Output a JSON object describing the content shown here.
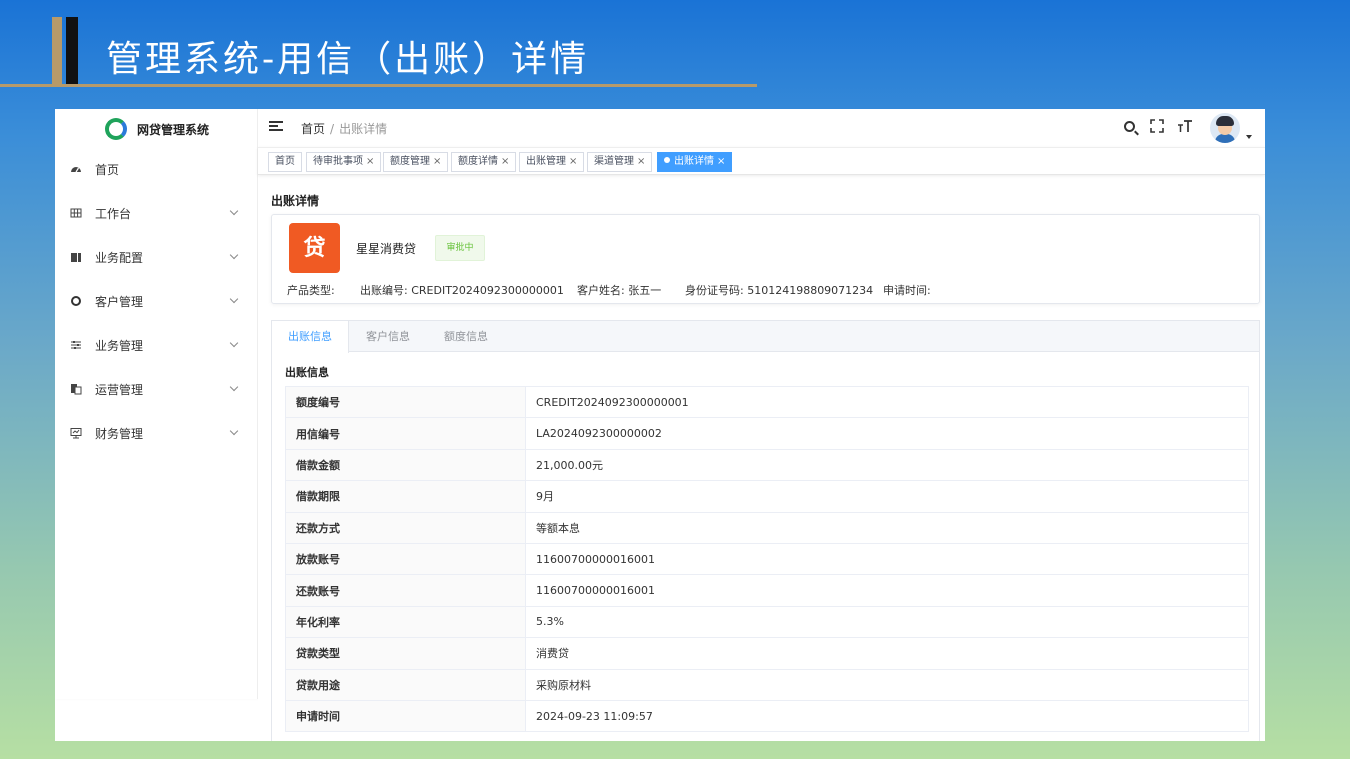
{
  "slide": {
    "title": "管理系统-用信（出账）详情"
  },
  "app": {
    "name": "网贷管理系统"
  },
  "sidebar": {
    "items": [
      {
        "label": "首页",
        "icon": "dashboard-icon",
        "has_children": false
      },
      {
        "label": "工作台",
        "icon": "grid-icon",
        "has_children": true
      },
      {
        "label": "业务配置",
        "icon": "book-icon",
        "has_children": true
      },
      {
        "label": "客户管理",
        "icon": "ring-icon",
        "has_children": true
      },
      {
        "label": "业务管理",
        "icon": "sliders-icon",
        "has_children": true
      },
      {
        "label": "运营管理",
        "icon": "copy-icon",
        "has_children": true
      },
      {
        "label": "财务管理",
        "icon": "monitor-icon",
        "has_children": true
      }
    ]
  },
  "breadcrumb": {
    "home": "首页",
    "separator": "/",
    "current": "出账详情"
  },
  "tags": [
    {
      "label": "首页",
      "closable": false,
      "active": false
    },
    {
      "label": "待审批事项",
      "closable": true,
      "active": false
    },
    {
      "label": "额度管理",
      "closable": true,
      "active": false
    },
    {
      "label": "额度详情",
      "closable": true,
      "active": false
    },
    {
      "label": "出账管理",
      "closable": true,
      "active": false
    },
    {
      "label": "渠道管理",
      "closable": true,
      "active": false
    },
    {
      "label": "出账详情",
      "closable": true,
      "active": true
    }
  ],
  "page": {
    "title": "出账详情"
  },
  "summary": {
    "icon_char": "贷",
    "product_name": "星星消费贷",
    "status": "审批中",
    "product_type": "产品类型:",
    "credit_no": "出账编号: CREDIT2024092300000001",
    "customer_name": "客户姓名: 张五一",
    "id_number": "身份证号码: 510124198809071234",
    "apply_time": "申请时间:"
  },
  "tabs": [
    {
      "label": "出账信息",
      "active": true
    },
    {
      "label": "客户信息",
      "active": false
    },
    {
      "label": "额度信息",
      "active": false
    }
  ],
  "section": {
    "title": "出账信息"
  },
  "detail_rows": [
    {
      "label": "额度编号",
      "value": "CREDIT2024092300000001"
    },
    {
      "label": "用信编号",
      "value": "LA2024092300000002"
    },
    {
      "label": "借款金额",
      "value": "21,000.00元"
    },
    {
      "label": "借款期限",
      "value": "9月"
    },
    {
      "label": "还款方式",
      "value": "等额本息"
    },
    {
      "label": "放款账号",
      "value": "11600700000016001"
    },
    {
      "label": "还款账号",
      "value": "11600700000016001"
    },
    {
      "label": "年化利率",
      "value": "5.3%"
    },
    {
      "label": "贷款类型",
      "value": "消费贷"
    },
    {
      "label": "贷款用途",
      "value": "采购原材料"
    },
    {
      "label": "申请时间",
      "value": "2024-09-23 11:09:57"
    }
  ],
  "colors": {
    "primary": "#409eff",
    "product_icon": "#f05a23",
    "status_text": "#67c23a"
  }
}
